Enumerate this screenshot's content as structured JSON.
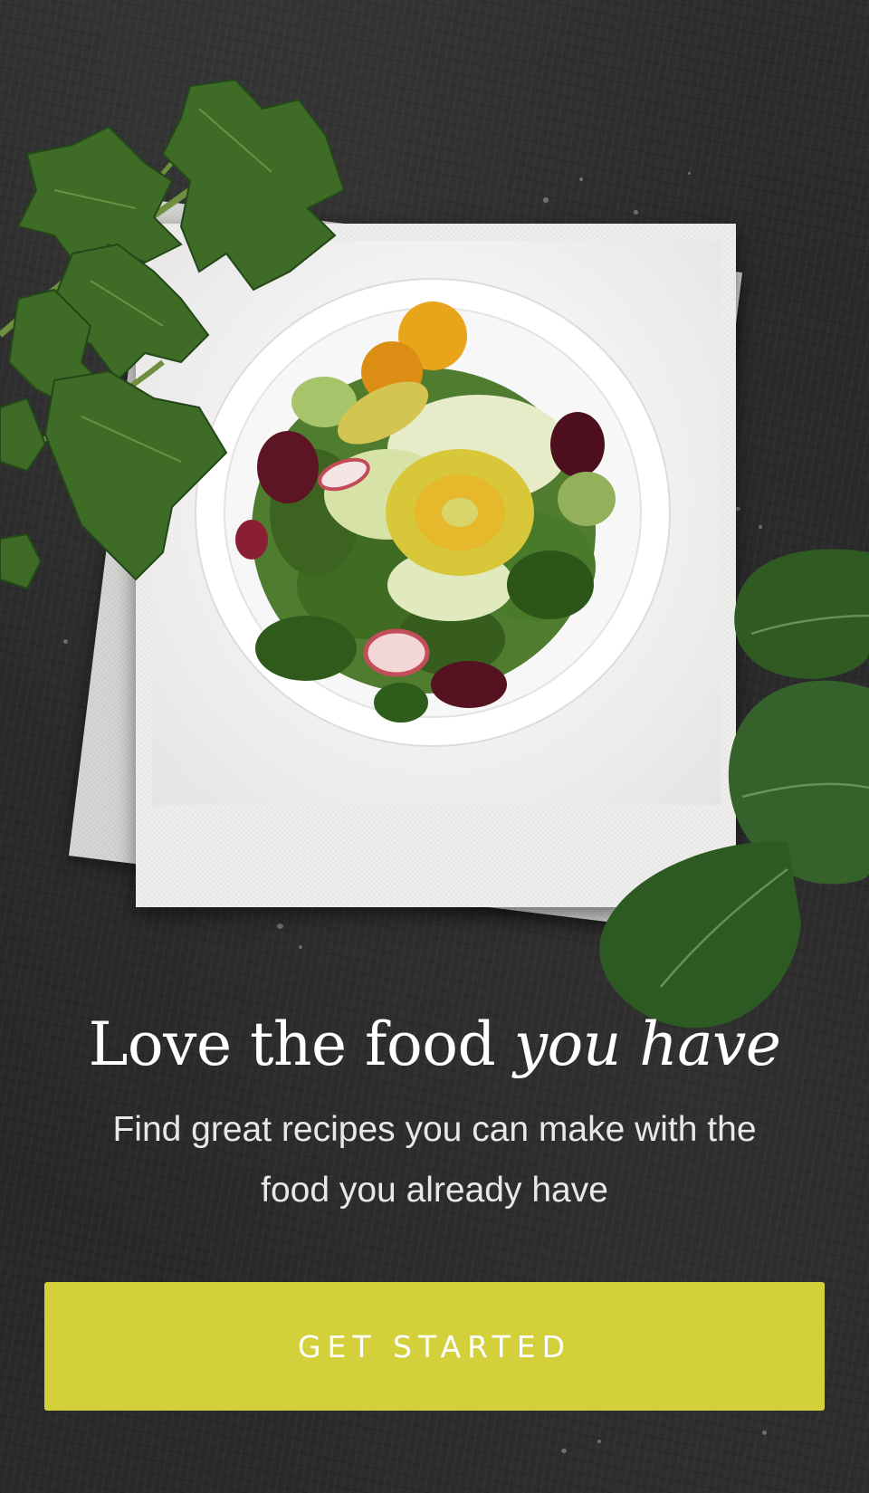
{
  "onboarding": {
    "headline_regular": "Love the food ",
    "headline_italic": "you have",
    "subtitle": "Find great recipes you can make with the food you already have",
    "cta_label": "GET STARTED"
  },
  "colors": {
    "background": "#2b2b2b",
    "cta_background": "#d3d03c",
    "cta_text": "#ffffff",
    "headline_text": "#ffffff"
  },
  "icons": {
    "photo": "salad-plate-photo",
    "decor_left": "parsley-leaves",
    "decor_right": "spinach-leaves"
  }
}
